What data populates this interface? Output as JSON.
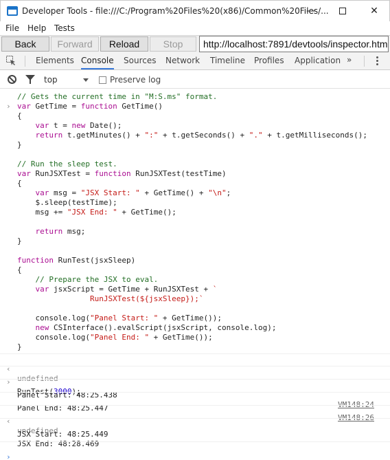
{
  "window": {
    "title": "Developer Tools - file:///C:/Program%20Files%20(x86)/Common%20Files/...",
    "minimize": "—",
    "close": "✕"
  },
  "menu": [
    "File",
    "Help",
    "Tests"
  ],
  "nav": {
    "back": "Back",
    "forward": "Forward",
    "reload": "Reload",
    "stop": "Stop",
    "url": "http://localhost:7891/devtools/inspector.html"
  },
  "tabs": [
    "Elements",
    "Console",
    "Sources",
    "Network",
    "Timeline",
    "Profiles",
    "Application"
  ],
  "tabs_more": "»",
  "active_tab": "Console",
  "filter": {
    "context": "top",
    "preserve_log": "Preserve log"
  },
  "console": {
    "code_lines": [
      [
        [
          "c-comment",
          "// Gets the current time in \"M:S.ms\" format."
        ]
      ],
      [
        [
          "c-key",
          "var"
        ],
        [
          "c-plain",
          " GetTime = "
        ],
        [
          "c-key",
          "function"
        ],
        [
          "c-plain",
          " GetTime()"
        ]
      ],
      [
        [
          "c-plain",
          "{"
        ]
      ],
      [
        [
          "c-plain",
          "    "
        ],
        [
          "c-key",
          "var"
        ],
        [
          "c-plain",
          " t = "
        ],
        [
          "c-key",
          "new"
        ],
        [
          "c-plain",
          " Date();"
        ]
      ],
      [
        [
          "c-plain",
          "    "
        ],
        [
          "c-key",
          "return"
        ],
        [
          "c-plain",
          " t.getMinutes() + "
        ],
        [
          "c-str",
          "\":\""
        ],
        [
          "c-plain",
          " + t.getSeconds() + "
        ],
        [
          "c-str",
          "\".\""
        ],
        [
          "c-plain",
          " + t.getMilliseconds();"
        ]
      ],
      [
        [
          "c-plain",
          "}"
        ]
      ],
      [
        [
          "c-plain",
          ""
        ]
      ],
      [
        [
          "c-comment",
          "// Run the sleep test."
        ]
      ],
      [
        [
          "c-key",
          "var"
        ],
        [
          "c-plain",
          " RunJSXTest = "
        ],
        [
          "c-key",
          "function"
        ],
        [
          "c-plain",
          " RunJSXTest(testTime)"
        ]
      ],
      [
        [
          "c-plain",
          "{"
        ]
      ],
      [
        [
          "c-plain",
          "    "
        ],
        [
          "c-key",
          "var"
        ],
        [
          "c-plain",
          " msg = "
        ],
        [
          "c-str",
          "\"JSX Start: \""
        ],
        [
          "c-plain",
          " + GetTime() + "
        ],
        [
          "c-str",
          "\"\\n\""
        ],
        [
          "c-plain",
          ";"
        ]
      ],
      [
        [
          "c-plain",
          "    $.sleep(testTime);"
        ]
      ],
      [
        [
          "c-plain",
          "    msg += "
        ],
        [
          "c-str",
          "\"JSX End: \""
        ],
        [
          "c-plain",
          " + GetTime();"
        ]
      ],
      [
        [
          "c-plain",
          ""
        ]
      ],
      [
        [
          "c-plain",
          "    "
        ],
        [
          "c-key",
          "return"
        ],
        [
          "c-plain",
          " msg;"
        ]
      ],
      [
        [
          "c-plain",
          "}"
        ]
      ],
      [
        [
          "c-plain",
          ""
        ]
      ],
      [
        [
          "c-key",
          "function"
        ],
        [
          "c-plain",
          " RunTest(jsxSleep)"
        ]
      ],
      [
        [
          "c-plain",
          "{"
        ]
      ],
      [
        [
          "c-plain",
          "    "
        ],
        [
          "c-comment",
          "// Prepare the JSX to eval."
        ]
      ],
      [
        [
          "c-plain",
          "    "
        ],
        [
          "c-key",
          "var"
        ],
        [
          "c-plain",
          " jsxScript = GetTime + RunJSXTest + "
        ],
        [
          "c-str",
          "`"
        ]
      ],
      [
        [
          "c-str",
          "                RunJSXTest(${jsxSleep});`"
        ]
      ],
      [
        [
          "c-plain",
          ""
        ]
      ],
      [
        [
          "c-plain",
          "    console.log("
        ],
        [
          "c-str",
          "\"Panel Start: \""
        ],
        [
          "c-plain",
          " + GetTime());"
        ]
      ],
      [
        [
          "c-plain",
          "    "
        ],
        [
          "c-key",
          "new"
        ],
        [
          "c-plain",
          " CSInterface().evalScript(jsxScript, console.log);"
        ]
      ],
      [
        [
          "c-plain",
          "    console.log("
        ],
        [
          "c-str",
          "\"Panel End: \""
        ],
        [
          "c-plain",
          " + GetTime());"
        ]
      ],
      [
        [
          "c-plain",
          "}"
        ]
      ]
    ],
    "result1": "undefined",
    "command2_prefix": "RunTest(",
    "command2_num": "3000",
    "command2_suffix": ");",
    "log1": "Panel Start: 48:25.438",
    "log1_src": "VM148:24",
    "log2": "Panel End: 48:25.447",
    "log2_src": "VM148:26",
    "result2": "undefined",
    "jsx1": "JSX Start: 48:25.449",
    "jsx2": "JSX End: 48:28.469",
    "prompt": "›",
    "result_marker": "‹",
    "input_marker": "›"
  }
}
